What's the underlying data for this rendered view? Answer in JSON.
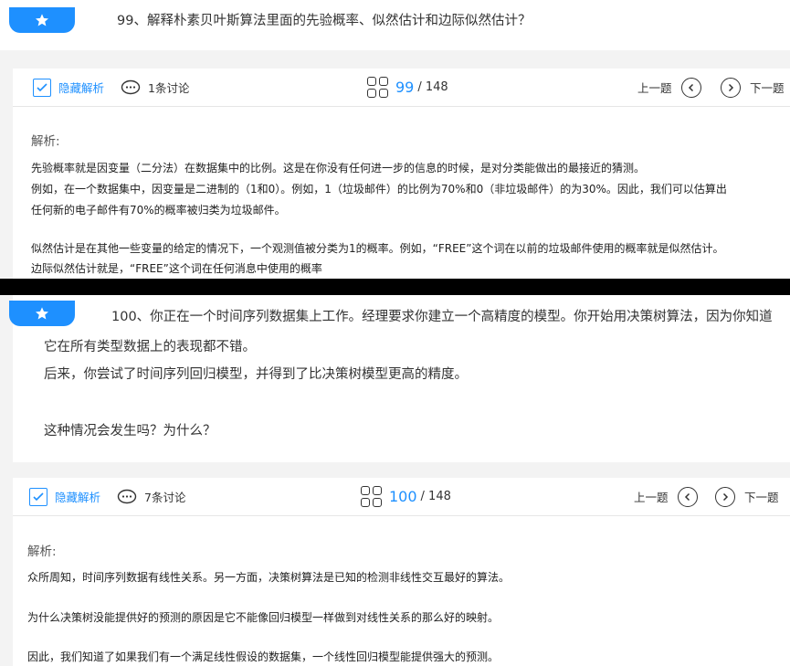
{
  "q1": {
    "text": "99、解释朴素贝叶斯算法里面的先验概率、似然估计和边际似然估计？",
    "toolbar": {
      "hide": "隐藏解析",
      "discuss": "1条讨论",
      "current": "99",
      "total": "/ 148",
      "prev": "上一题",
      "next": "下一题"
    },
    "analysis": {
      "title": "解析:",
      "lines": [
        "先验概率就是因变量（二分法）在数据集中的比例。这是在你没有任何进一步的信息的时候，是对分类能做出的最接近的猜测。",
        "例如，在一个数据集中，因变量是二进制的（1和0）。例如，1（垃圾邮件）的比例为70%和0（非垃圾邮件）的为30%。因此，我们可以估算出",
        "任何新的电子邮件有70%的概率被归类为垃圾邮件。",
        "似然估计是在其他一些变量的给定的情况下，一个观测值被分类为1的概率。例如，“FREE”这个词在以前的垃圾邮件使用的概率就是似然估计。",
        "边际似然估计就是，“FREE”这个词在任何消息中使用的概率"
      ]
    }
  },
  "q2": {
    "text_lines": [
      "100、你正在一个时间序列数据集上工作。经理要求你建立一个高精度的模型。你开始用决策树算法，因为你知道",
      "它在所有类型数据上的表现都不错。",
      "后来，你尝试了时间序列回归模型，并得到了比决策树模型更高的精度。",
      "这种情况会发生吗？为什么？"
    ],
    "toolbar": {
      "hide": "隐藏解析",
      "discuss": "7条讨论",
      "current": "100",
      "total": "/ 148",
      "prev": "上一题",
      "next": "下一题"
    },
    "analysis": {
      "title": "解析:",
      "lines": [
        "众所周知，时间序列数据有线性关系。另一方面，决策树算法是已知的检测非线性交互最好的算法。",
        "为什么决策树没能提供好的预测的原因是它不能像回归模型一样做到对线性关系的那么好的映射。",
        "因此，我们知道了如果我们有一个满足线性假设的数据集，一个线性回归模型能提供强大的预测。"
      ]
    }
  },
  "colors": {
    "accent": "#1e90ff",
    "separator": "#000000"
  }
}
